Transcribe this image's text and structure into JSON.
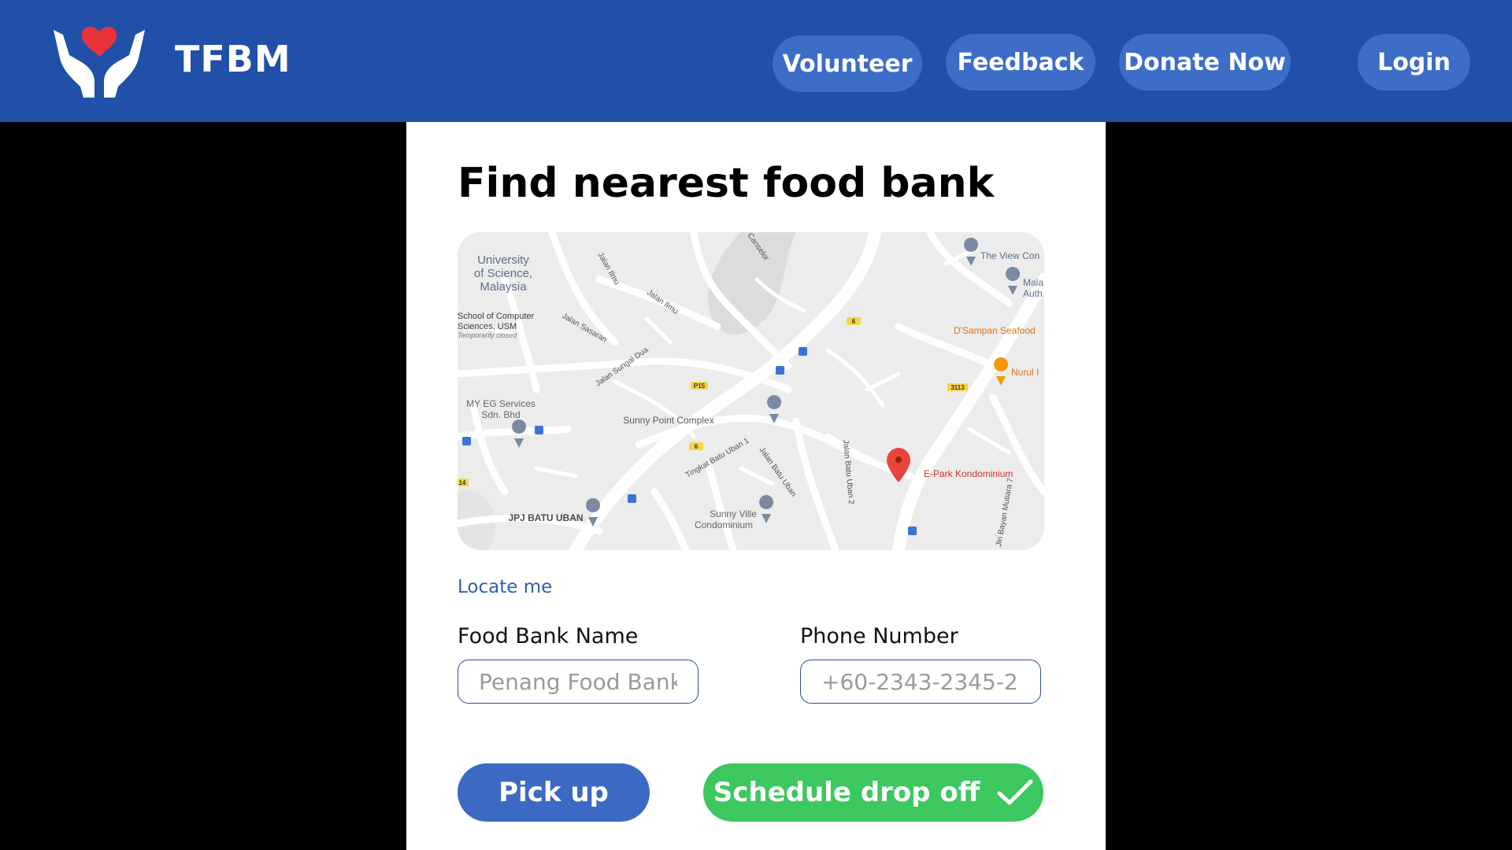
{
  "header": {
    "brand": "TFBM",
    "nav": {
      "volunteer": "Volunteer",
      "feedback": "Feedback",
      "donate": "Donate Now",
      "login": "Login"
    }
  },
  "main": {
    "title": "Find nearest food bank",
    "locate_label": "Locate me",
    "map": {
      "labels": {
        "usm": [
          "University",
          "of Science,",
          "Malaysia"
        ],
        "school": [
          "School of Computer",
          "Sciences, USM",
          "Temporarily closed"
        ],
        "myeg": [
          "MY EG Services",
          "Sdn. Bhd"
        ],
        "sunnypoint": "Sunny Point Complex",
        "sunnyville": [
          "Sunny Ville",
          "Condominium"
        ],
        "jpj": "JPJ BATU UBAN",
        "epark": "E-Park Kondominium",
        "viewcon": "The View Con",
        "mala": [
          "Mala",
          "Auth"
        ],
        "dsampan": "D'Sampan Seafood",
        "nurul": "Nurul I",
        "jalan_ilmu_1": "Jalan Ilmu",
        "jalan_ilmu_2": "Jalan Ilmu",
        "jalan_sasaran": "Jalan Sasaran",
        "jalan_sungai_dua": "Jalan Sungai Dua",
        "canselor": "Canselor",
        "tingkat_batu_uban": "Tingkat Batu Uban 1",
        "jalan_batu_uban": "Jalan Batu Uban",
        "jalan_batu_uban_2": "Jalan Batu Uban 2",
        "bayan_mutiara": "Jln Bayan Mutiara 7",
        "route_6a": "6",
        "route_6b": "6",
        "route_p15": "P15",
        "route_3113": "3113",
        "route_14": "14"
      }
    },
    "form": {
      "food_bank_label": "Food Bank Name",
      "food_bank_placeholder": "Penang Food Bank",
      "phone_label": "Phone Number",
      "phone_placeholder": "+60-2343-2345-2"
    },
    "buttons": {
      "pickup": "Pick up",
      "dropoff": "Schedule drop off"
    }
  },
  "colors": {
    "header": "#2050a8",
    "nav_button": "#3d6dc6",
    "pickup": "#3c69c4",
    "dropoff": "#3cc85e",
    "heart": "#e8333a"
  }
}
